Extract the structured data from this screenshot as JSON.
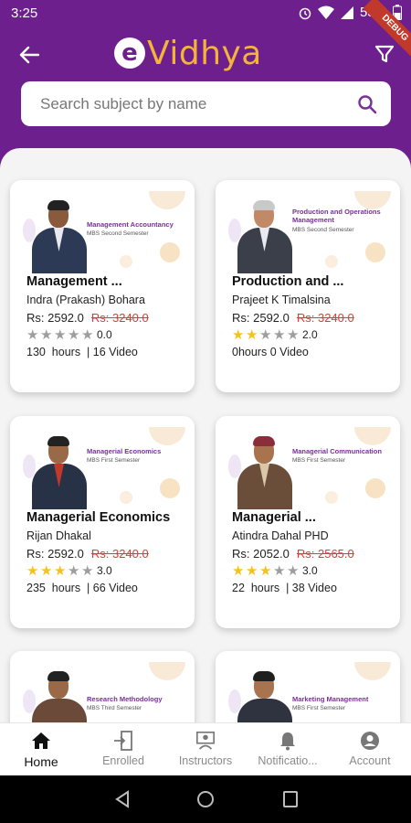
{
  "status_bar": {
    "time": "3:25",
    "battery": "53%"
  },
  "header": {
    "logo_letter": "e",
    "logo_word": "Vidhya",
    "debug_label": "DEBUG",
    "brand_color": "#6e1f8e",
    "logo_color": "#f4b33a"
  },
  "search": {
    "placeholder": "Search subject by name",
    "value": ""
  },
  "courses": [
    {
      "banner_title": "Management Accountancy",
      "banner_sub": "MBS Second Semester",
      "title": "Management ...",
      "teacher": "Indra  (Prakash) Bohara",
      "price": "Rs:  2592.0",
      "old_price": "Rs: 3240.0",
      "rating": 0,
      "rating_text": "0.0",
      "meta": "130  hours  | 16 Video"
    },
    {
      "banner_title": "Production and Operations Management",
      "banner_sub": "MBS Second Semester",
      "title": "Production and ...",
      "teacher": "Prajeet K Timalsina",
      "price": "Rs:  2592.0",
      "old_price": "Rs: 3240.0",
      "rating": 2,
      "rating_text": "2.0",
      "meta": "0hours 0 Video"
    },
    {
      "banner_title": "Managerial Economics",
      "banner_sub": "MBS First Semester",
      "title": "Managerial Economics",
      "teacher": "Rijan Dhakal",
      "price": "Rs:  2592.0",
      "old_price": "Rs: 3240.0",
      "rating": 3,
      "rating_text": "3.0",
      "meta": "235  hours  | 66 Video"
    },
    {
      "banner_title": "Managerial Communication",
      "banner_sub": "MBS First Semester",
      "title": "Managerial ...",
      "teacher": "Atindra Dahal PHD",
      "price": "Rs:  2052.0",
      "old_price": "Rs: 2565.0",
      "rating": 3,
      "rating_text": "3.0",
      "meta": "22  hours  | 38 Video"
    },
    {
      "banner_title": "Research Methodology",
      "banner_sub": "MBS Third Semester",
      "title": "",
      "teacher": "",
      "price": "",
      "old_price": "",
      "rating": 0,
      "rating_text": "",
      "meta": ""
    },
    {
      "banner_title": "Marketing Management",
      "banner_sub": "MBS First Semester",
      "title": "",
      "teacher": "",
      "price": "",
      "old_price": "",
      "rating": 0,
      "rating_text": "",
      "meta": ""
    }
  ],
  "bottom_nav": [
    {
      "label": "Home",
      "icon": "home-icon",
      "active": true
    },
    {
      "label": "Enrolled",
      "icon": "enrolled-icon",
      "active": false
    },
    {
      "label": "Instructors",
      "icon": "instructors-icon",
      "active": false
    },
    {
      "label": "Notificatio...",
      "icon": "bell-icon",
      "active": false
    },
    {
      "label": "Account",
      "icon": "account-icon",
      "active": false
    }
  ]
}
